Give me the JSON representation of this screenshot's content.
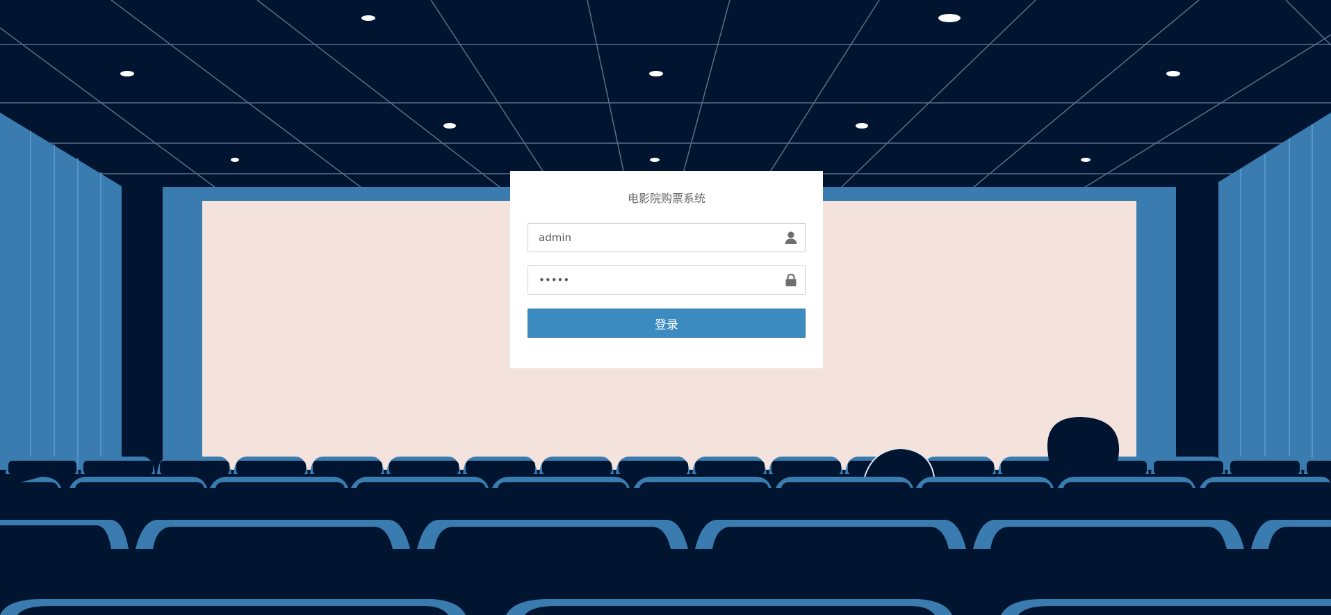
{
  "login": {
    "title": "电影院购票系统",
    "username_value": "admin",
    "password_value": "admin",
    "submit_label": "登录"
  },
  "icons": {
    "username": "user-icon",
    "password": "lock-icon"
  },
  "colors": {
    "background": "#011530",
    "accent": "#3b8bc0",
    "screen": "#f4e2dc",
    "panel": "#ffffff"
  }
}
